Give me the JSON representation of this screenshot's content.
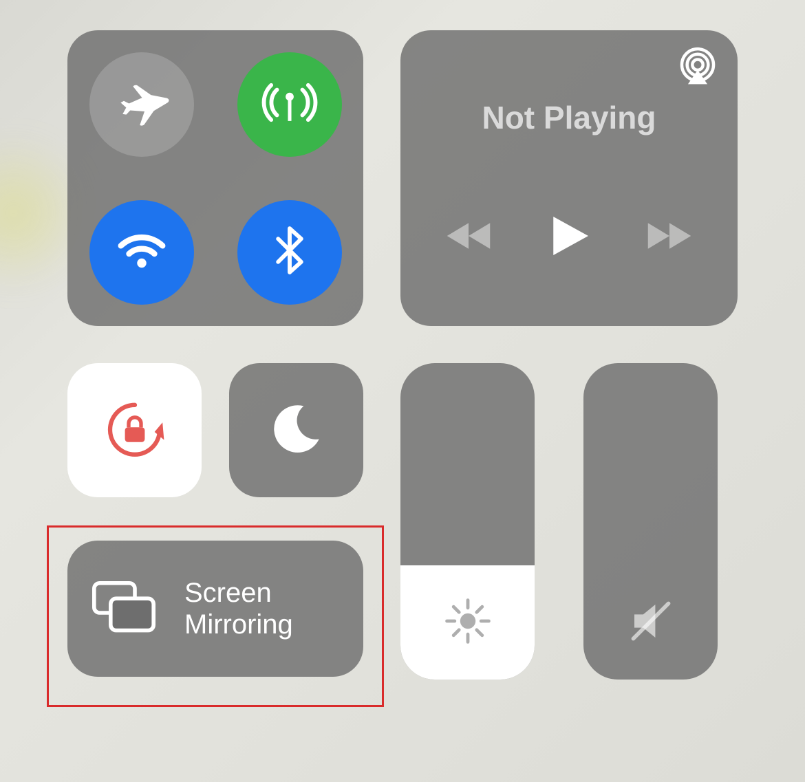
{
  "connectivity": {
    "airplane_mode": {
      "on": false
    },
    "cellular": {
      "on": true
    },
    "wifi": {
      "on": true
    },
    "bluetooth": {
      "on": true
    }
  },
  "media": {
    "status_label": "Not Playing"
  },
  "rotation_lock": {
    "on": true
  },
  "do_not_disturb": {
    "on": false
  },
  "screen_mirroring": {
    "label_line1": "Screen",
    "label_line2": "Mirroring"
  },
  "brightness": {
    "percent": 36
  },
  "volume": {
    "percent": 0,
    "muted": true
  },
  "colors": {
    "green": "#3ab54a",
    "blue": "#1e74ee",
    "panel": "rgba(110,110,110,0.82)",
    "highlight_red": "#d92b2b",
    "rotation_lock_accent": "#e55a55"
  }
}
